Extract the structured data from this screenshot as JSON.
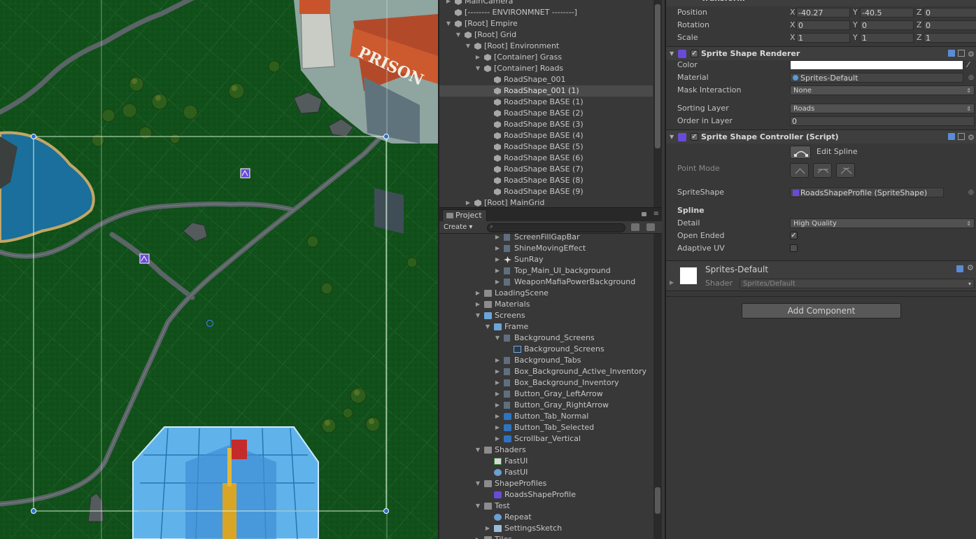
{
  "hierarchy": {
    "items": [
      {
        "label": "MainCamera",
        "indent": 0,
        "arrow": "right",
        "selected": false
      },
      {
        "label": "[--------   ENVIRONMNET   --------]",
        "indent": 0,
        "arrow": "none",
        "selected": false
      },
      {
        "label": "[Root] Empire",
        "indent": 0,
        "arrow": "down",
        "selected": false
      },
      {
        "label": "[Root] Grid",
        "indent": 1,
        "arrow": "down",
        "selected": false
      },
      {
        "label": "[Root] Environment",
        "indent": 2,
        "arrow": "down",
        "selected": false
      },
      {
        "label": "[Container] Grass",
        "indent": 3,
        "arrow": "right",
        "selected": false
      },
      {
        "label": "[Container] Roads",
        "indent": 3,
        "arrow": "down",
        "selected": false
      },
      {
        "label": "RoadShape_001",
        "indent": 4,
        "arrow": "none",
        "selected": false
      },
      {
        "label": "RoadShape_001 (1)",
        "indent": 4,
        "arrow": "none",
        "selected": true
      },
      {
        "label": "RoadShape BASE (1)",
        "indent": 4,
        "arrow": "none",
        "selected": false
      },
      {
        "label": "RoadShape BASE (2)",
        "indent": 4,
        "arrow": "none",
        "selected": false
      },
      {
        "label": "RoadShape BASE (3)",
        "indent": 4,
        "arrow": "none",
        "selected": false
      },
      {
        "label": "RoadShape BASE (4)",
        "indent": 4,
        "arrow": "none",
        "selected": false
      },
      {
        "label": "RoadShape BASE (5)",
        "indent": 4,
        "arrow": "none",
        "selected": false
      },
      {
        "label": "RoadShape BASE (6)",
        "indent": 4,
        "arrow": "none",
        "selected": false
      },
      {
        "label": "RoadShape BASE (7)",
        "indent": 4,
        "arrow": "none",
        "selected": false
      },
      {
        "label": "RoadShape BASE (8)",
        "indent": 4,
        "arrow": "none",
        "selected": false
      },
      {
        "label": "RoadShape BASE (9)",
        "indent": 4,
        "arrow": "none",
        "selected": false
      },
      {
        "label": "[Root] MainGrid",
        "indent": 2,
        "arrow": "right",
        "selected": false
      }
    ]
  },
  "project": {
    "tab_label": "Project",
    "create_label": "Create",
    "items": [
      {
        "label": "ScreenFillGapBar",
        "indent": 2,
        "arrow": "right",
        "icon": "sprite"
      },
      {
        "label": "ShineMovingEffect",
        "indent": 2,
        "arrow": "right",
        "icon": "sprite"
      },
      {
        "label": "SunRay",
        "indent": 2,
        "arrow": "right",
        "icon": "star"
      },
      {
        "label": "Top_Main_UI_background",
        "indent": 2,
        "arrow": "right",
        "icon": "sprite"
      },
      {
        "label": "WeaponMafiaPowerBackground",
        "indent": 2,
        "arrow": "right",
        "icon": "sprite"
      },
      {
        "label": "LoadingScene",
        "indent": 0,
        "arrow": "right",
        "icon": "folder"
      },
      {
        "label": "Materials",
        "indent": 0,
        "arrow": "right",
        "icon": "folder"
      },
      {
        "label": "Screens",
        "indent": 0,
        "arrow": "down",
        "icon": "folder-blue"
      },
      {
        "label": "Frame",
        "indent": 1,
        "arrow": "down",
        "icon": "folder-blue"
      },
      {
        "label": "Background_Screens",
        "indent": 2,
        "arrow": "down",
        "icon": "sprite"
      },
      {
        "label": "Background_Screens",
        "indent": 3,
        "arrow": "none",
        "icon": "subsprite"
      },
      {
        "label": "Background_Tabs",
        "indent": 2,
        "arrow": "right",
        "icon": "sprite"
      },
      {
        "label": "Box_Background_Active_Inventory",
        "indent": 2,
        "arrow": "right",
        "icon": "sprite"
      },
      {
        "label": "Box_Background_Inventory",
        "indent": 2,
        "arrow": "right",
        "icon": "sprite"
      },
      {
        "label": "Button_Gray_LeftArrow",
        "indent": 2,
        "arrow": "right",
        "icon": "sprite"
      },
      {
        "label": "Button_Gray_RightArrow",
        "indent": 2,
        "arrow": "right",
        "icon": "sprite"
      },
      {
        "label": "Button_Tab_Normal",
        "indent": 2,
        "arrow": "right",
        "icon": "sprite-blue"
      },
      {
        "label": "Button_Tab_Selected",
        "indent": 2,
        "arrow": "right",
        "icon": "sprite-blue"
      },
      {
        "label": "Scrollbar_Vertical",
        "indent": 2,
        "arrow": "right",
        "icon": "sprite-blue"
      },
      {
        "label": "Shaders",
        "indent": 0,
        "arrow": "down",
        "icon": "folder"
      },
      {
        "label": "FastUI",
        "indent": 1,
        "arrow": "none",
        "icon": "shader"
      },
      {
        "label": "FastUI",
        "indent": 1,
        "arrow": "none",
        "icon": "material"
      },
      {
        "label": "ShapeProfiles",
        "indent": 0,
        "arrow": "down",
        "icon": "folder"
      },
      {
        "label": "RoadsShapeProfile",
        "indent": 1,
        "arrow": "none",
        "icon": "spriteshape"
      },
      {
        "label": "Test",
        "indent": 0,
        "arrow": "down",
        "icon": "folder"
      },
      {
        "label": "Repeat",
        "indent": 1,
        "arrow": "none",
        "icon": "material"
      },
      {
        "label": "SettingsSketch",
        "indent": 1,
        "arrow": "right",
        "icon": "prefab"
      },
      {
        "label": "Tiles",
        "indent": 0,
        "arrow": "right",
        "icon": "folder"
      }
    ]
  },
  "inspector": {
    "transform": {
      "title": "Transform",
      "position": {
        "label": "Position",
        "x": "-40.27",
        "y": "-40.5",
        "z": "0"
      },
      "rotation": {
        "label": "Rotation",
        "x": "0",
        "y": "0",
        "z": "0"
      },
      "scale": {
        "label": "Scale",
        "x": "1",
        "y": "1",
        "z": "1"
      }
    },
    "axes": {
      "x": "X",
      "y": "Y",
      "z": "Z"
    },
    "renderer": {
      "title": "Sprite Shape Renderer",
      "color_label": "Color",
      "material_label": "Material",
      "material_value": "Sprites-Default",
      "mask_label": "Mask Interaction",
      "mask_value": "None",
      "sorting_label": "Sorting Layer",
      "sorting_value": "Roads",
      "order_label": "Order in Layer",
      "order_value": "0"
    },
    "controller": {
      "title": "Sprite Shape Controller (Script)",
      "edit_spline_label": "Edit Spline",
      "point_mode_label": "Point Mode",
      "spriteshape_label": "SpriteShape",
      "spriteshape_value": "RoadsShapeProfile (SpriteShape)",
      "spline_section": "Spline",
      "detail_label": "Detail",
      "detail_value": "High Quality",
      "open_ended_label": "Open Ended",
      "adaptive_uv_label": "Adaptive UV"
    },
    "material": {
      "name": "Sprites-Default",
      "shader_label": "Shader",
      "shader_value": "Sprites/Default"
    },
    "add_component_label": "Add Component"
  },
  "scene": {
    "sign_text": "PRISON"
  },
  "colors": {
    "grass": "#0f4a14",
    "road": "#5a6266",
    "accent_blue": "#3e7bd6",
    "spriteshape_icon": "#6a4bd8"
  }
}
